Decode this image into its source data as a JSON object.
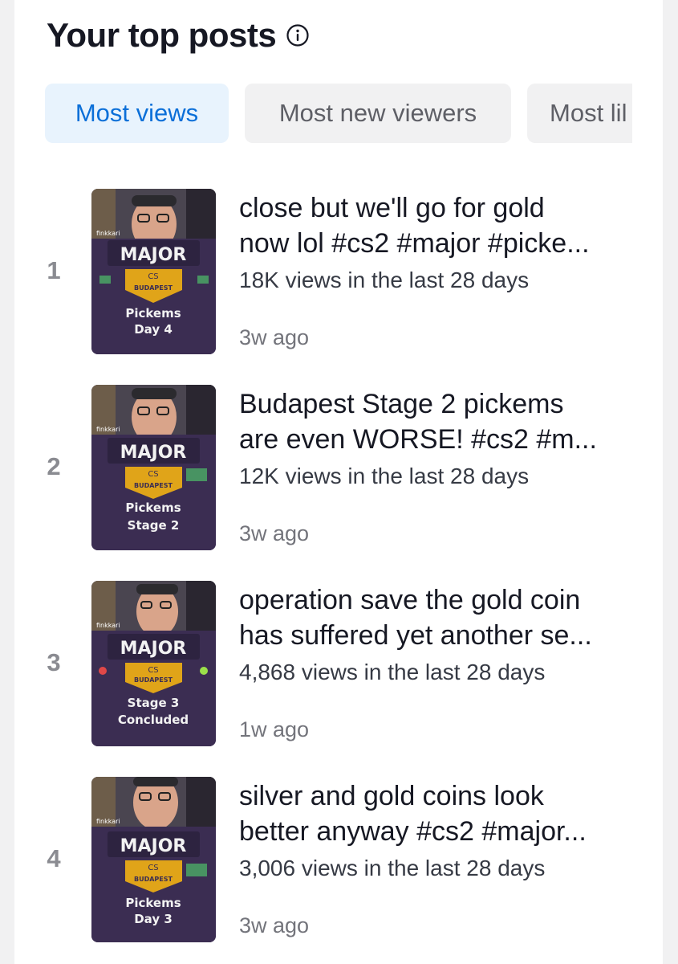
{
  "header": {
    "title": "Your top posts",
    "info_icon": "info-circle-icon"
  },
  "tabs": [
    {
      "label": "Most views",
      "active": true
    },
    {
      "label": "Most new viewers",
      "active": false
    },
    {
      "label": "Most lil",
      "active": false
    }
  ],
  "posts": [
    {
      "rank": "1",
      "title_line1": "close but we'll go for gold",
      "title_line2": "now lol #cs2 #major #picke...",
      "views": "18K views in the last 28 days",
      "ago": "3w ago",
      "thumb": {
        "badge": "MAJOR",
        "sub": "CS",
        "city": "BUDAPEST",
        "line1": "Pickems",
        "line2": "Day 4",
        "streamer": "finkkari"
      }
    },
    {
      "rank": "2",
      "title_line1": "Budapest Stage 2 pickems",
      "title_line2": "are even WORSE! #cs2 #m...",
      "views": "12K views in the last 28 days",
      "ago": "3w ago",
      "thumb": {
        "badge": "MAJOR",
        "sub": "CS",
        "city": "BUDAPEST",
        "line1": "Pickems",
        "line2": "Stage 2",
        "streamer": "finkkari"
      }
    },
    {
      "rank": "3",
      "title_line1": "operation save the gold coin",
      "title_line2": "has suffered yet another se...",
      "views": "4,868 views in the last 28 days",
      "ago": "1w ago",
      "thumb": {
        "badge": "MAJOR",
        "sub": "CS",
        "city": "BUDAPEST",
        "line1": "Stage 3",
        "line2": "Concluded",
        "streamer": "finkkari"
      }
    },
    {
      "rank": "4",
      "title_line1": "silver and gold coins look",
      "title_line2": "better anyway #cs2 #major...",
      "views": "3,006 views in the last 28 days",
      "ago": "3w ago",
      "thumb": {
        "badge": "MAJOR",
        "sub": "CS",
        "city": "BUDAPEST",
        "line1": "Pickems",
        "line2": "Day 3",
        "streamer": "finkkari"
      }
    }
  ],
  "colors": {
    "accent": "#0b6fd8",
    "active_tab_bg": "#e8f3fd",
    "tab_bg": "#f1f1f2",
    "thumb_bg": "#3b2d52",
    "gold": "#e0a419"
  }
}
